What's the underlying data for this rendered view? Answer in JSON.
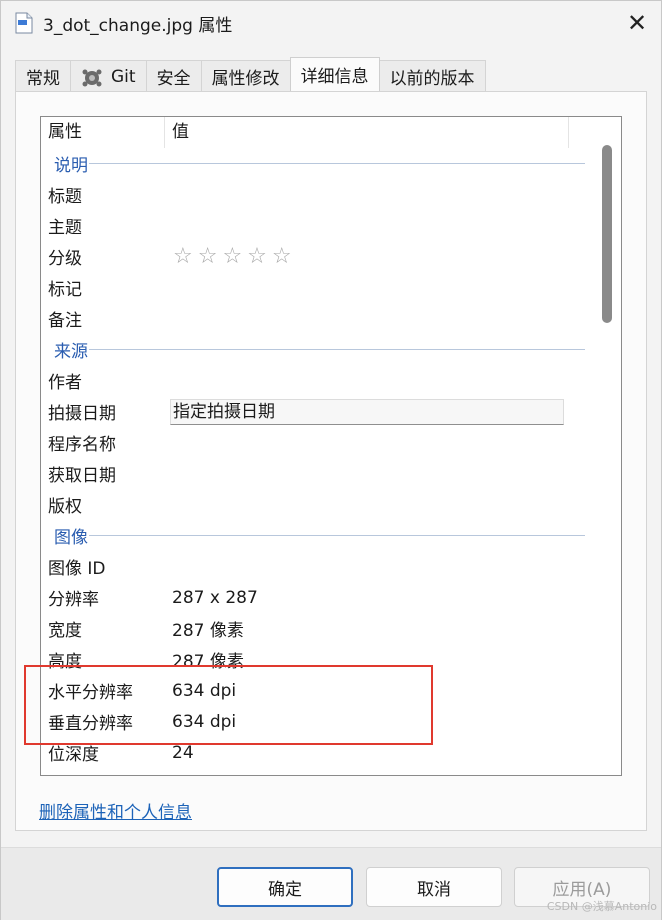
{
  "window": {
    "title": "3_dot_change.jpg 属性",
    "close_glyph": "✕"
  },
  "tabs": [
    {
      "label": "常规"
    },
    {
      "label": "Git",
      "icon": "git-tortoise-icon"
    },
    {
      "label": "安全"
    },
    {
      "label": "属性修改"
    },
    {
      "label": "详细信息",
      "active": true
    },
    {
      "label": "以前的版本"
    }
  ],
  "list": {
    "header": {
      "col1": "属性",
      "col2": "值"
    },
    "groups": {
      "description": "说明",
      "origin": "来源",
      "image": "图像"
    },
    "description_rows": [
      {
        "key": "标题",
        "value": ""
      },
      {
        "key": "主题",
        "value": ""
      },
      {
        "key": "分级",
        "value": "☆☆☆☆☆"
      },
      {
        "key": "标记",
        "value": ""
      },
      {
        "key": "备注",
        "value": ""
      }
    ],
    "origin_rows": [
      {
        "key": "作者",
        "value": ""
      },
      {
        "key": "拍摄日期",
        "value": "指定拍摄日期"
      },
      {
        "key": "程序名称",
        "value": ""
      },
      {
        "key": "获取日期",
        "value": ""
      },
      {
        "key": "版权",
        "value": ""
      }
    ],
    "image_rows": [
      {
        "key": "图像 ID",
        "value": ""
      },
      {
        "key": "分辨率",
        "value": "287 x 287"
      },
      {
        "key": "宽度",
        "value": "287 像素"
      },
      {
        "key": "高度",
        "value": "287 像素"
      },
      {
        "key": "水平分辨率",
        "value": "634 dpi"
      },
      {
        "key": "垂直分辨率",
        "value": "634 dpi"
      },
      {
        "key": "位深度",
        "value": "24"
      }
    ]
  },
  "links": {
    "remove_properties": "删除属性和个人信息"
  },
  "buttons": {
    "ok": "确定",
    "cancel": "取消",
    "apply": "应用(A)"
  },
  "watermark": "CSDN @浅慕Antonio",
  "colors": {
    "highlight_box": "#e0392e",
    "link": "#1d63b8",
    "group_header": "#2a5db0"
  }
}
